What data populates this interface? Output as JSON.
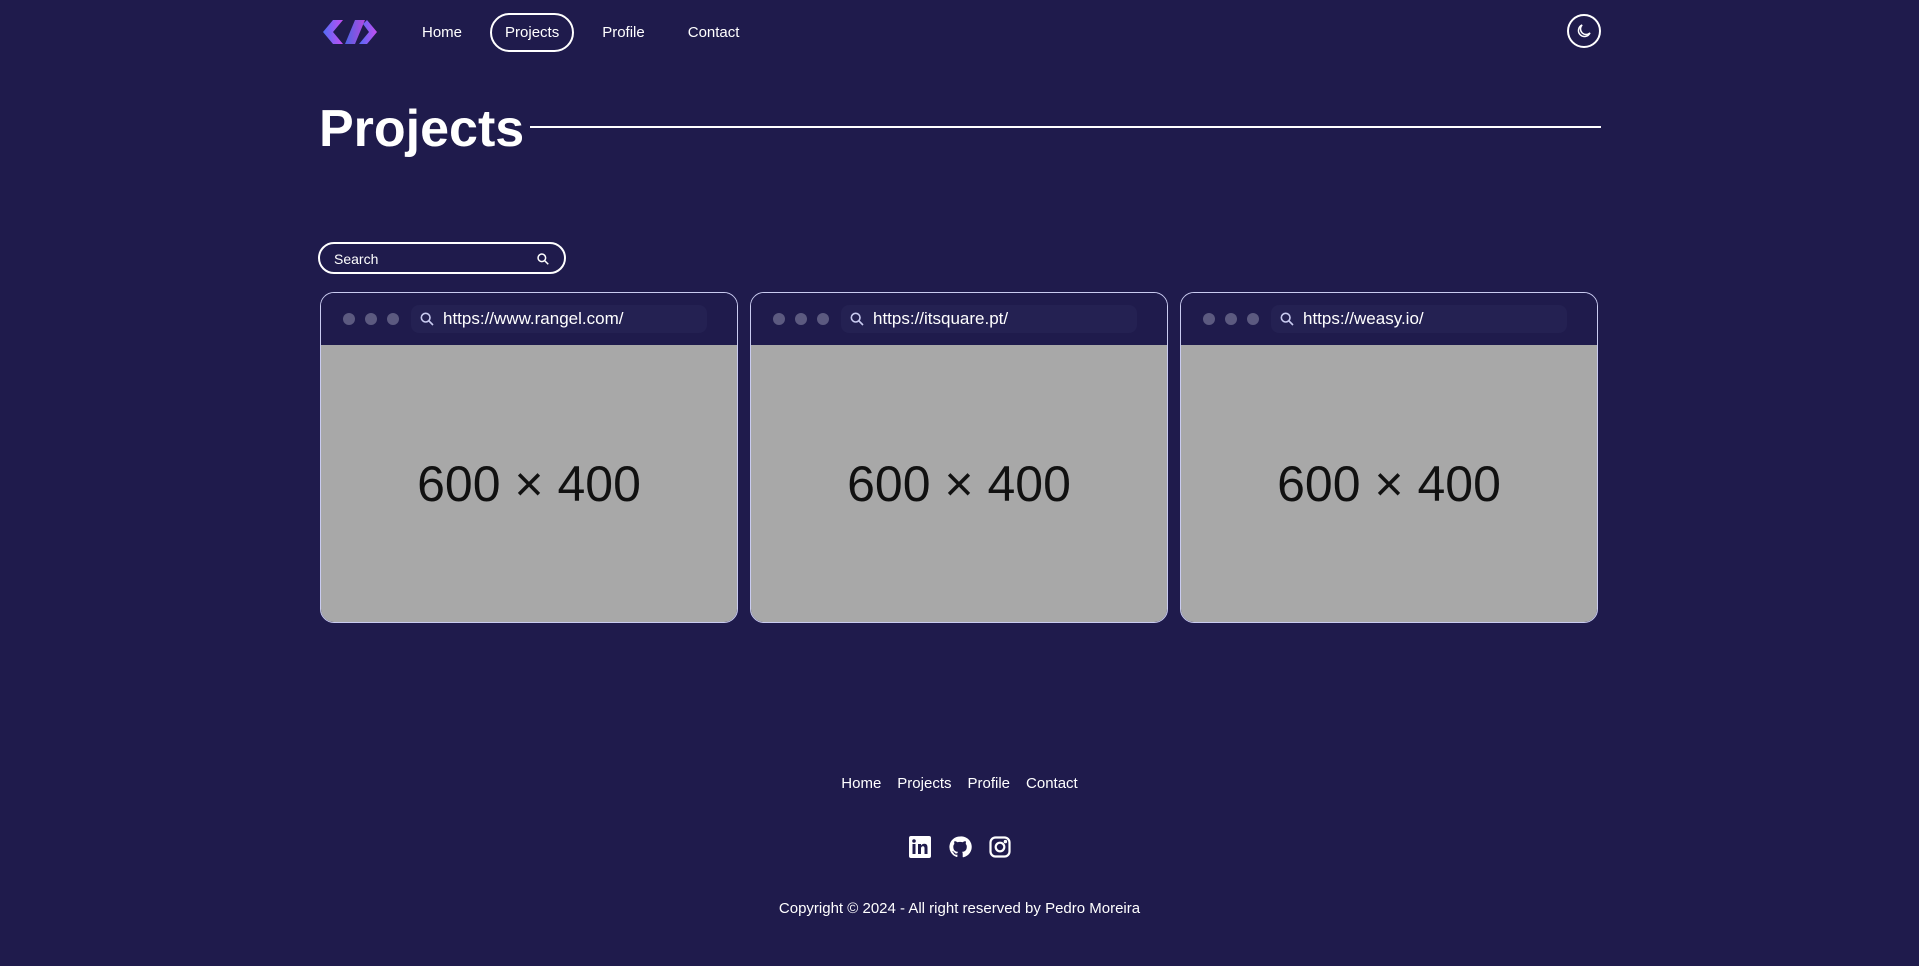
{
  "header": {
    "logo_icon": "code-brackets-logo",
    "nav": [
      {
        "label": "Home",
        "active": false
      },
      {
        "label": "Projects",
        "active": true
      },
      {
        "label": "Profile",
        "active": false
      },
      {
        "label": "Contact",
        "active": false
      }
    ],
    "theme_icon": "moon-icon"
  },
  "main": {
    "title": "Projects",
    "search": {
      "placeholder": "Search",
      "value": "",
      "icon": "search-icon"
    },
    "projects": [
      {
        "url": "https://www.rangel.com/",
        "image_label": "600 × 400"
      },
      {
        "url": "https://itsquare.pt/",
        "image_label": "600 × 400"
      },
      {
        "url": "https://weasy.io/",
        "image_label": "600 × 400"
      }
    ]
  },
  "footer": {
    "links": [
      "Home",
      "Projects",
      "Profile",
      "Contact"
    ],
    "socials": [
      "linkedin-icon",
      "github-icon",
      "instagram-icon"
    ],
    "copyright": "Copyright © 2024 - All right reserved by Pedro Moreira"
  },
  "colors": {
    "background": "#1f1b4c",
    "text": "#ffffff",
    "placeholder_image": "#a8a8a8",
    "logo_gradient": [
      "#4f6cf5",
      "#c54df2"
    ]
  }
}
